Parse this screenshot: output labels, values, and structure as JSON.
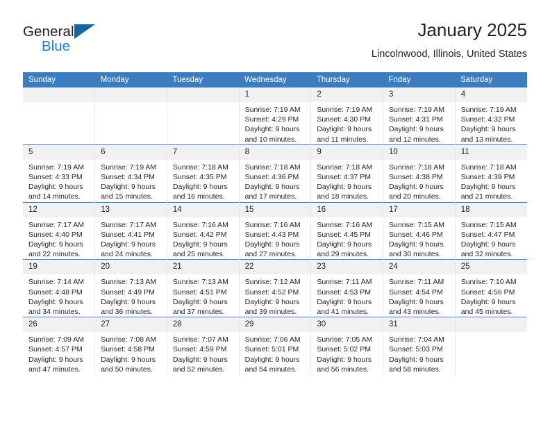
{
  "brand": {
    "name_top": "General",
    "name_bottom": "Blue",
    "logo_icon": "triangle-logo-icon",
    "accent_color": "#1b7fd4",
    "triangle_color": "#15659f"
  },
  "header": {
    "title": "January 2025",
    "location": "Lincolnwood, Illinois, United States"
  },
  "calendar": {
    "header_bg": "#3a7ec1",
    "daynum_bg": "#f1f1f1",
    "weekdays": [
      "Sunday",
      "Monday",
      "Tuesday",
      "Wednesday",
      "Thursday",
      "Friday",
      "Saturday"
    ],
    "weeks": [
      [
        {
          "day": "",
          "lines": []
        },
        {
          "day": "",
          "lines": []
        },
        {
          "day": "",
          "lines": []
        },
        {
          "day": "1",
          "lines": [
            "Sunrise: 7:19 AM",
            "Sunset: 4:29 PM",
            "Daylight: 9 hours",
            "and 10 minutes."
          ]
        },
        {
          "day": "2",
          "lines": [
            "Sunrise: 7:19 AM",
            "Sunset: 4:30 PM",
            "Daylight: 9 hours",
            "and 11 minutes."
          ]
        },
        {
          "day": "3",
          "lines": [
            "Sunrise: 7:19 AM",
            "Sunset: 4:31 PM",
            "Daylight: 9 hours",
            "and 12 minutes."
          ]
        },
        {
          "day": "4",
          "lines": [
            "Sunrise: 7:19 AM",
            "Sunset: 4:32 PM",
            "Daylight: 9 hours",
            "and 13 minutes."
          ]
        }
      ],
      [
        {
          "day": "5",
          "lines": [
            "Sunrise: 7:19 AM",
            "Sunset: 4:33 PM",
            "Daylight: 9 hours",
            "and 14 minutes."
          ]
        },
        {
          "day": "6",
          "lines": [
            "Sunrise: 7:19 AM",
            "Sunset: 4:34 PM",
            "Daylight: 9 hours",
            "and 15 minutes."
          ]
        },
        {
          "day": "7",
          "lines": [
            "Sunrise: 7:18 AM",
            "Sunset: 4:35 PM",
            "Daylight: 9 hours",
            "and 16 minutes."
          ]
        },
        {
          "day": "8",
          "lines": [
            "Sunrise: 7:18 AM",
            "Sunset: 4:36 PM",
            "Daylight: 9 hours",
            "and 17 minutes."
          ]
        },
        {
          "day": "9",
          "lines": [
            "Sunrise: 7:18 AM",
            "Sunset: 4:37 PM",
            "Daylight: 9 hours",
            "and 18 minutes."
          ]
        },
        {
          "day": "10",
          "lines": [
            "Sunrise: 7:18 AM",
            "Sunset: 4:38 PM",
            "Daylight: 9 hours",
            "and 20 minutes."
          ]
        },
        {
          "day": "11",
          "lines": [
            "Sunrise: 7:18 AM",
            "Sunset: 4:39 PM",
            "Daylight: 9 hours",
            "and 21 minutes."
          ]
        }
      ],
      [
        {
          "day": "12",
          "lines": [
            "Sunrise: 7:17 AM",
            "Sunset: 4:40 PM",
            "Daylight: 9 hours",
            "and 22 minutes."
          ]
        },
        {
          "day": "13",
          "lines": [
            "Sunrise: 7:17 AM",
            "Sunset: 4:41 PM",
            "Daylight: 9 hours",
            "and 24 minutes."
          ]
        },
        {
          "day": "14",
          "lines": [
            "Sunrise: 7:16 AM",
            "Sunset: 4:42 PM",
            "Daylight: 9 hours",
            "and 25 minutes."
          ]
        },
        {
          "day": "15",
          "lines": [
            "Sunrise: 7:16 AM",
            "Sunset: 4:43 PM",
            "Daylight: 9 hours",
            "and 27 minutes."
          ]
        },
        {
          "day": "16",
          "lines": [
            "Sunrise: 7:16 AM",
            "Sunset: 4:45 PM",
            "Daylight: 9 hours",
            "and 29 minutes."
          ]
        },
        {
          "day": "17",
          "lines": [
            "Sunrise: 7:15 AM",
            "Sunset: 4:46 PM",
            "Daylight: 9 hours",
            "and 30 minutes."
          ]
        },
        {
          "day": "18",
          "lines": [
            "Sunrise: 7:15 AM",
            "Sunset: 4:47 PM",
            "Daylight: 9 hours",
            "and 32 minutes."
          ]
        }
      ],
      [
        {
          "day": "19",
          "lines": [
            "Sunrise: 7:14 AM",
            "Sunset: 4:48 PM",
            "Daylight: 9 hours",
            "and 34 minutes."
          ]
        },
        {
          "day": "20",
          "lines": [
            "Sunrise: 7:13 AM",
            "Sunset: 4:49 PM",
            "Daylight: 9 hours",
            "and 36 minutes."
          ]
        },
        {
          "day": "21",
          "lines": [
            "Sunrise: 7:13 AM",
            "Sunset: 4:51 PM",
            "Daylight: 9 hours",
            "and 37 minutes."
          ]
        },
        {
          "day": "22",
          "lines": [
            "Sunrise: 7:12 AM",
            "Sunset: 4:52 PM",
            "Daylight: 9 hours",
            "and 39 minutes."
          ]
        },
        {
          "day": "23",
          "lines": [
            "Sunrise: 7:11 AM",
            "Sunset: 4:53 PM",
            "Daylight: 9 hours",
            "and 41 minutes."
          ]
        },
        {
          "day": "24",
          "lines": [
            "Sunrise: 7:11 AM",
            "Sunset: 4:54 PM",
            "Daylight: 9 hours",
            "and 43 minutes."
          ]
        },
        {
          "day": "25",
          "lines": [
            "Sunrise: 7:10 AM",
            "Sunset: 4:56 PM",
            "Daylight: 9 hours",
            "and 45 minutes."
          ]
        }
      ],
      [
        {
          "day": "26",
          "lines": [
            "Sunrise: 7:09 AM",
            "Sunset: 4:57 PM",
            "Daylight: 9 hours",
            "and 47 minutes."
          ]
        },
        {
          "day": "27",
          "lines": [
            "Sunrise: 7:08 AM",
            "Sunset: 4:58 PM",
            "Daylight: 9 hours",
            "and 50 minutes."
          ]
        },
        {
          "day": "28",
          "lines": [
            "Sunrise: 7:07 AM",
            "Sunset: 4:59 PM",
            "Daylight: 9 hours",
            "and 52 minutes."
          ]
        },
        {
          "day": "29",
          "lines": [
            "Sunrise: 7:06 AM",
            "Sunset: 5:01 PM",
            "Daylight: 9 hours",
            "and 54 minutes."
          ]
        },
        {
          "day": "30",
          "lines": [
            "Sunrise: 7:05 AM",
            "Sunset: 5:02 PM",
            "Daylight: 9 hours",
            "and 56 minutes."
          ]
        },
        {
          "day": "31",
          "lines": [
            "Sunrise: 7:04 AM",
            "Sunset: 5:03 PM",
            "Daylight: 9 hours",
            "and 58 minutes."
          ]
        },
        {
          "day": "",
          "lines": []
        }
      ]
    ]
  }
}
